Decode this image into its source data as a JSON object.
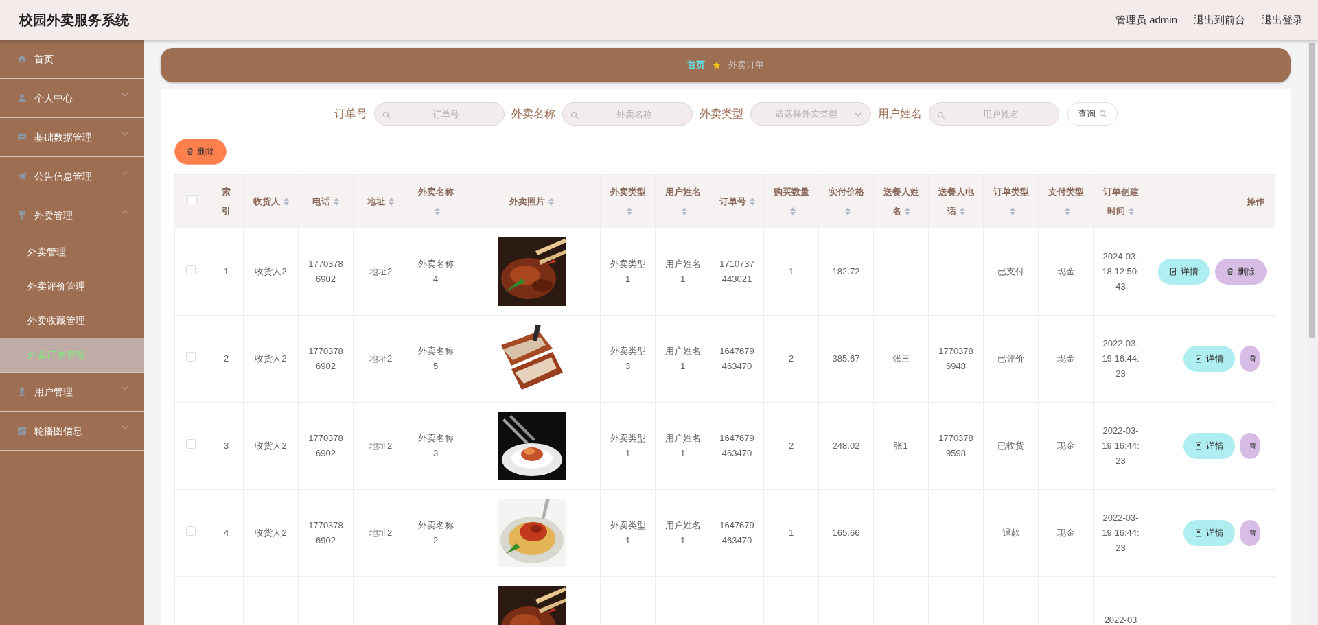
{
  "app_title": "校园外卖服务系统",
  "header_links": [
    "管理员 admin",
    "退出到前台",
    "退出登录"
  ],
  "sidebar": {
    "items": [
      {
        "label": "首页"
      },
      {
        "label": "个人中心",
        "expanded": false
      },
      {
        "label": "基础数据管理",
        "expanded": false
      },
      {
        "label": "公告信息管理",
        "expanded": false
      },
      {
        "label": "外卖管理",
        "expanded": true,
        "children": [
          {
            "label": "外卖管理",
            "selected": false
          },
          {
            "label": "外卖评价管理",
            "selected": false
          },
          {
            "label": "外卖收藏管理",
            "selected": false
          },
          {
            "label": "外卖订单管理",
            "selected": true
          }
        ]
      },
      {
        "label": "用户管理",
        "expanded": false
      },
      {
        "label": "轮播图信息",
        "expanded": false
      }
    ]
  },
  "breadcrumb": [
    "首页",
    "外卖订单"
  ],
  "search": {
    "fields": [
      {
        "label": "订单号",
        "kind": "text",
        "placeholder": "订单号"
      },
      {
        "label": "外卖名称",
        "kind": "text",
        "placeholder": "外卖名称"
      },
      {
        "label": "外卖类型",
        "kind": "select",
        "placeholder": "请选择外卖类型"
      },
      {
        "label": "用户姓名",
        "kind": "text",
        "placeholder": "用户姓名"
      }
    ],
    "button": "查询"
  },
  "delete_button": "删除",
  "table": {
    "select_all_checked": false,
    "columns": [
      {
        "kind": "checkbox"
      },
      {
        "label": "索引",
        "sortable": false
      },
      {
        "label": "收货人",
        "sortable": true
      },
      {
        "label": "电话",
        "sortable": true
      },
      {
        "label": "地址",
        "sortable": true
      },
      {
        "label": "外卖名称",
        "sortable": true
      },
      {
        "label": "外卖照片",
        "sortable": true
      },
      {
        "label": "外卖类型",
        "sortable": true
      },
      {
        "label": "用户姓名",
        "sortable": true
      },
      {
        "label": "订单号",
        "sortable": true
      },
      {
        "label": "购买数量",
        "sortable": true
      },
      {
        "label": "实付价格",
        "sortable": true
      },
      {
        "label": "送餐人姓名",
        "sortable": true
      },
      {
        "label": "送餐人电话",
        "sortable": true
      },
      {
        "label": "订单类型",
        "sortable": true
      },
      {
        "label": "支付类型",
        "sortable": true
      },
      {
        "label": "订单创建时间",
        "sortable": true
      },
      {
        "label": "操作",
        "sortable": false,
        "kind": "actions"
      }
    ],
    "rows": [
      {
        "checked": false,
        "index": "1",
        "receiver": "收货人2",
        "phone": "17703786902",
        "address": "地址2",
        "food_name": "外卖名称4",
        "photo": {
          "kind": "picture"
        },
        "food_type": "外卖类型1",
        "user_name": "用户姓名1",
        "order_no": "1710737443021",
        "quantity": "1",
        "price": "182.72",
        "order_type": "已支付",
        "pay_type": "现金",
        "created_at": "2024-03-18 12:50:43",
        "actions": [
          {
            "kind": "detail",
            "label": "详情"
          },
          {
            "kind": "delete",
            "label": "删除"
          }
        ]
      },
      {
        "checked": false,
        "index": "2",
        "receiver": "收货人2",
        "phone": "17703786902",
        "address": "地址2",
        "food_name": "外卖名称5",
        "photo": {
          "kind": "picture"
        },
        "food_type": "外卖类型3",
        "user_name": "用户姓名1",
        "order_no": "1647679463470",
        "quantity": "2",
        "price": "385.67",
        "courier_name": "张三",
        "courier_phone": "17703786948",
        "order_type": "已评价",
        "pay_type": "现金",
        "created_at": "2022-03-19 16:44:23",
        "actions": [
          {
            "kind": "detail",
            "label": "详情"
          },
          {
            "kind": "delete"
          }
        ]
      },
      {
        "checked": false,
        "index": "3",
        "receiver": "收货人2",
        "phone": "17703786902",
        "address": "地址2",
        "food_name": "外卖名称3",
        "photo": {
          "kind": "picture"
        },
        "food_type": "外卖类型1",
        "user_name": "用户姓名1",
        "order_no": "1647679463470",
        "quantity": "2",
        "price": "248.02",
        "courier_name": "张1",
        "courier_phone": "17703789598",
        "order_type": "已收货",
        "pay_type": "现金",
        "created_at": "2022-03-19 16:44:23",
        "actions": [
          {
            "kind": "detail",
            "label": "详情"
          },
          {
            "kind": "delete"
          }
        ]
      },
      {
        "checked": false,
        "index": "4",
        "receiver": "收货人2",
        "phone": "17703786902",
        "address": "地址2",
        "food_name": "外卖名称2",
        "photo": {
          "kind": "picture"
        },
        "food_type": "外卖类型1",
        "user_name": "用户姓名1",
        "order_no": "1647679463470",
        "quantity": "1",
        "price": "165.66",
        "order_type": "退款",
        "pay_type": "现金",
        "created_at": "2022-03-19 16:44:23",
        "actions": [
          {
            "kind": "detail",
            "label": "详情"
          },
          {
            "kind": "delete"
          }
        ]
      },
      {
        "photo": {
          "kind": "picture"
        },
        "created_at": "2022-03"
      }
    ]
  }
}
